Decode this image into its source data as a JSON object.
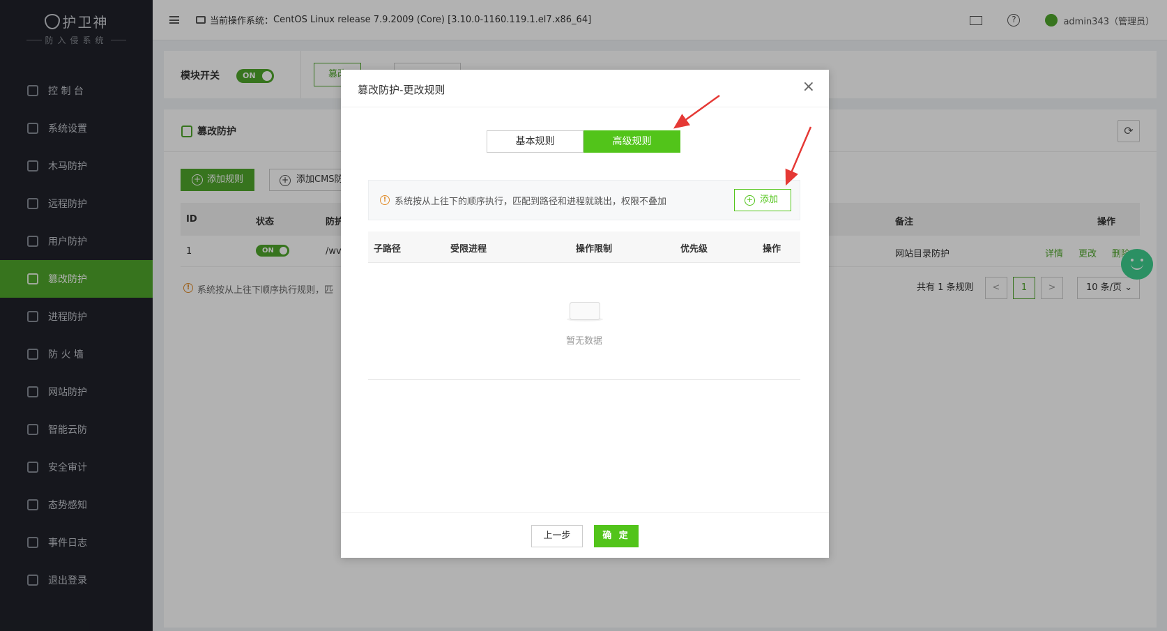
{
  "app": {
    "brand": "护卫神",
    "subtitle": "防入侵系统"
  },
  "sidebar": {
    "items": [
      {
        "label": "控 制 台",
        "icon": "dashboard-icon"
      },
      {
        "label": "系统设置",
        "icon": "settings-gear-icon"
      },
      {
        "label": "木马防护",
        "icon": "shield-trojan-icon"
      },
      {
        "label": "远程防护",
        "icon": "remote-desktop-icon"
      },
      {
        "label": "用户防护",
        "icon": "users-icon"
      },
      {
        "label": "篡改防护",
        "icon": "tamper-shield-icon",
        "active": true
      },
      {
        "label": "进程防护",
        "icon": "process-scan-icon"
      },
      {
        "label": "防 火 墙",
        "icon": "firewall-icon"
      },
      {
        "label": "网站防护",
        "icon": "website-shield-icon"
      },
      {
        "label": "智能云防",
        "icon": "cloud-robot-icon"
      },
      {
        "label": "安全审计",
        "icon": "audit-stamp-icon"
      },
      {
        "label": "态势感知",
        "icon": "radar-icon"
      },
      {
        "label": "事件日志",
        "icon": "log-book-icon"
      },
      {
        "label": "退出登录",
        "icon": "logout-icon"
      }
    ]
  },
  "header": {
    "os_label": "当前操作系统：",
    "os_value": "CentOS Linux release 7.9.2009 (Core) [3.10.0-1160.119.1.el7.x86_64]",
    "user": "admin343（管理员）"
  },
  "module": {
    "switch_label": "模块开关",
    "switch_state": "ON",
    "tab_partial": "篡改"
  },
  "tamper_panel": {
    "title": "篡改防护",
    "add_rule": "添加规则",
    "add_cms": "添加CMS防",
    "columns": {
      "id": "ID",
      "status": "状态",
      "path": "防护",
      "remark": "备注",
      "action": "操作"
    },
    "rows": [
      {
        "id": "1",
        "status": "ON",
        "path": "/wv",
        "remark": "网站目录防护",
        "detail": "详情",
        "edit": "更改",
        "delete": "删除"
      }
    ],
    "hint": "系统按从上往下顺序执行规则，匹",
    "total": "共有 1 条规则",
    "page_prev": "<",
    "page_current": "1",
    "page_next": ">",
    "page_size": "10 条/页"
  },
  "modal": {
    "title": "篡改防护-更改规则",
    "close": "×",
    "tabs": [
      "基本规则",
      "高级规则"
    ],
    "active_tab": 1,
    "notice": "系统按从上往下的顺序执行，匹配到路径和进程就跳出，权限不叠加",
    "add_label": "添加",
    "columns": [
      "子路径",
      "受限进程",
      "操作限制",
      "优先级",
      "操作"
    ],
    "empty_text": "暂无数据",
    "prev_label": "上一步",
    "ok_label": "确 定"
  },
  "colors": {
    "sidebar_bg": "#20222a",
    "accent": "#4fa72b",
    "modal_accent": "#52c41a",
    "annotation_arrow": "#e53935"
  }
}
